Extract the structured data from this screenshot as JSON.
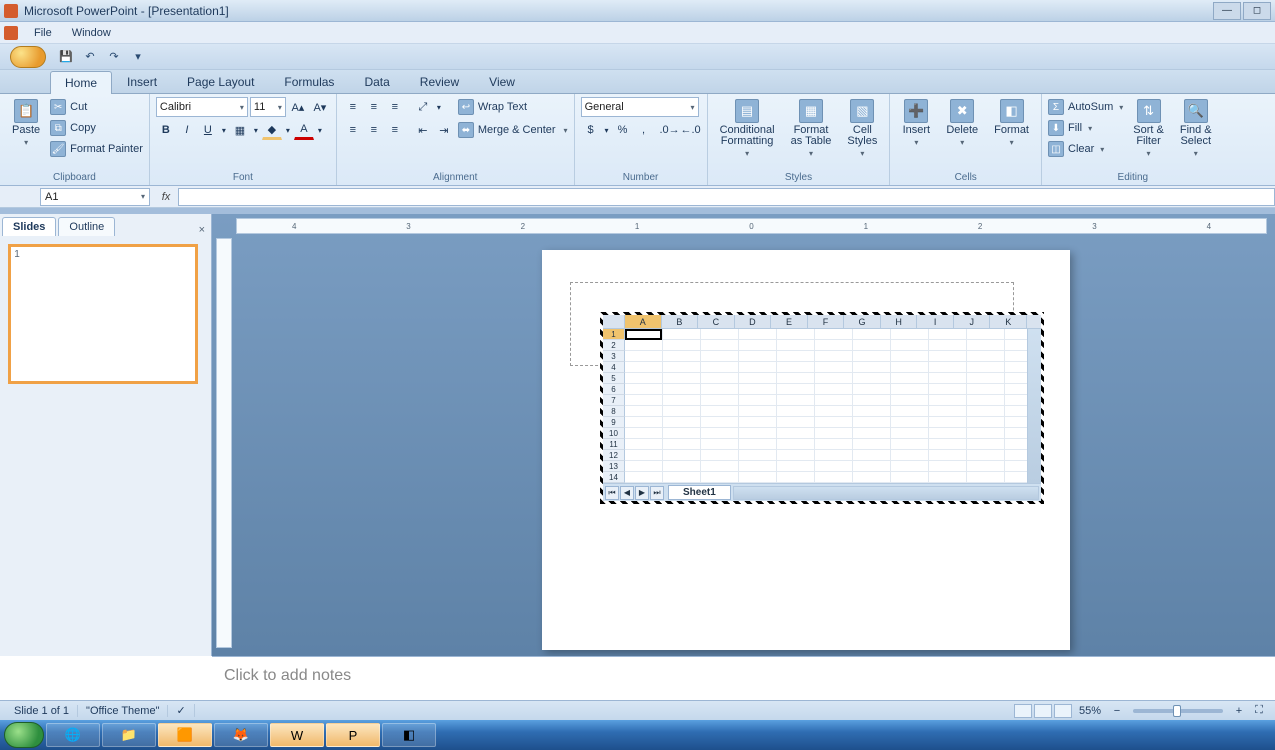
{
  "title": "Microsoft PowerPoint - [Presentation1]",
  "menu": {
    "file": "File",
    "window": "Window"
  },
  "tabs": {
    "home": "Home",
    "insert": "Insert",
    "pagelayout": "Page Layout",
    "formulas": "Formulas",
    "data": "Data",
    "review": "Review",
    "view": "View"
  },
  "clipboard": {
    "paste": "Paste",
    "cut": "Cut",
    "copy": "Copy",
    "formatpainter": "Format Painter",
    "label": "Clipboard"
  },
  "font": {
    "name": "Calibri",
    "size": "11",
    "label": "Font"
  },
  "alignment": {
    "wrap": "Wrap Text",
    "merge": "Merge & Center",
    "label": "Alignment"
  },
  "number": {
    "format": "General",
    "label": "Number"
  },
  "styles": {
    "cond": "Conditional\nFormatting",
    "table": "Format\nas Table",
    "cell": "Cell\nStyles",
    "label": "Styles"
  },
  "cells": {
    "insert": "Insert",
    "delete": "Delete",
    "format": "Format",
    "label": "Cells"
  },
  "editing": {
    "autosum": "AutoSum",
    "fill": "Fill",
    "clear": "Clear",
    "sort": "Sort &\nFilter",
    "find": "Find &\nSelect",
    "label": "Editing"
  },
  "namebox": "A1",
  "fx": "fx",
  "slidespanel": {
    "slides": "Slides",
    "outline": "Outline"
  },
  "excel": {
    "cols": [
      "A",
      "B",
      "C",
      "D",
      "E",
      "F",
      "G",
      "H",
      "I",
      "J",
      "K"
    ],
    "rows": [
      "1",
      "2",
      "3",
      "4",
      "5",
      "6",
      "7",
      "8",
      "9",
      "10",
      "11",
      "12",
      "13",
      "14"
    ],
    "sheet": "Sheet1"
  },
  "ruler_ticks": [
    "4",
    "3",
    "2",
    "1",
    "0",
    "1",
    "2",
    "3",
    "4"
  ],
  "notes": "Click to add notes",
  "status": {
    "slide": "Slide 1 of 1",
    "theme": "\"Office Theme\"",
    "zoom": "55%"
  }
}
